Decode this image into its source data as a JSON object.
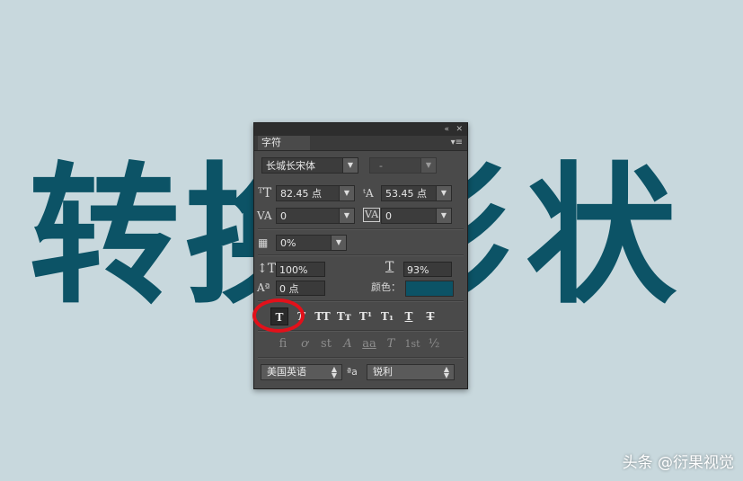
{
  "background": {
    "chars": [
      "转",
      "换",
      "形",
      "状"
    ],
    "color": "#0c5366",
    "bg": "#c8d8dd"
  },
  "panel": {
    "collapse_icon": "«",
    "close_icon": "✕",
    "tab_label": "字符",
    "menu_icon": "▾≡",
    "font_family": "长城长宋体",
    "font_style": "-",
    "font_size": "82.45 点",
    "leading": "53.45 点",
    "kerning": "0",
    "tracking": "0",
    "tsume": "0%",
    "vertical_scale": "100%",
    "horizontal_scale": "93%",
    "baseline_shift": "0 点",
    "color_label": "颜色：",
    "text_color": "#0c5366",
    "type_buttons": [
      "T",
      "T",
      "TT",
      "Tт",
      "T¹",
      "T₁",
      "T",
      "T"
    ],
    "opentype_buttons": [
      "ﬁ",
      "ơ",
      "st",
      "A",
      "aa",
      "T",
      "1st",
      "½"
    ],
    "language": "美国英语",
    "aa_label": "ªa",
    "antialias": "锐利"
  },
  "watermark": "头条 @衍果视觉"
}
